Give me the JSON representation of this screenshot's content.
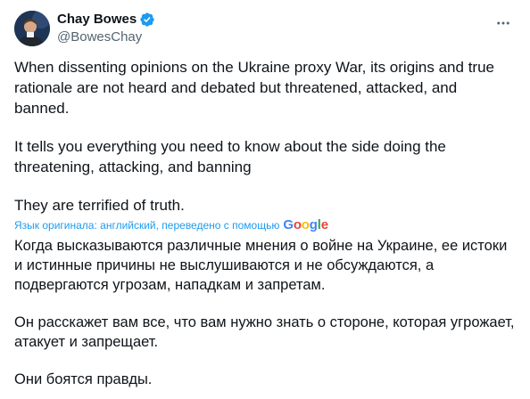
{
  "author": {
    "display_name": "Chay Bowes",
    "handle": "@BowesChay"
  },
  "original": {
    "paragraphs": [
      "When dissenting opinions on the Ukraine proxy War, its origins and true rationale are not heard and debated but threatened, attacked, and banned.",
      "It tells you everything you need to know about the side doing the threatening, attacking, and banning",
      "They are terrified of truth."
    ]
  },
  "translation": {
    "notice": "Язык оригинала: английский, переведено с помощью",
    "provider": "Google",
    "paragraphs": [
      "Когда высказываются различные мнения о войне на Украине, ее истоки и истинные причины не выслушиваются и не обсуждаются, а подвергаются угрозам, нападкам и запретам.",
      "Он расскажет вам все, что вам нужно знать о стороне, которая угрожает, атакует и запрещает.",
      "Они боятся правды."
    ]
  },
  "colors": {
    "text": "#0f1419",
    "secondary": "#536471",
    "accent": "#1d9bf0"
  },
  "icons": {
    "verified": "verified-badge-icon",
    "more": "more-horizontal-icon"
  }
}
